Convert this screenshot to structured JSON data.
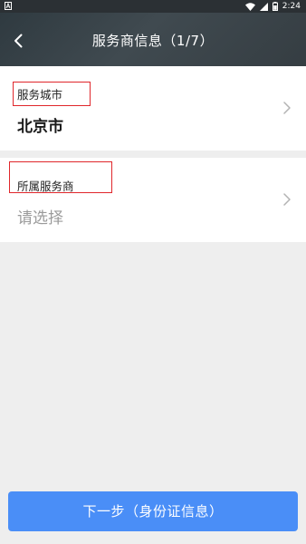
{
  "status_bar": {
    "time": "2:24"
  },
  "header": {
    "title": "服务商信息（1/7）"
  },
  "form": {
    "city": {
      "label": "服务城市",
      "value": "北京市"
    },
    "provider": {
      "label": "所属服务商",
      "placeholder": "请选择"
    }
  },
  "footer": {
    "next_label": "下一步（身份证信息）"
  },
  "colors": {
    "accent": "#4a8ef7",
    "header_bg": "#363f44",
    "highlight": "#e0262b"
  }
}
